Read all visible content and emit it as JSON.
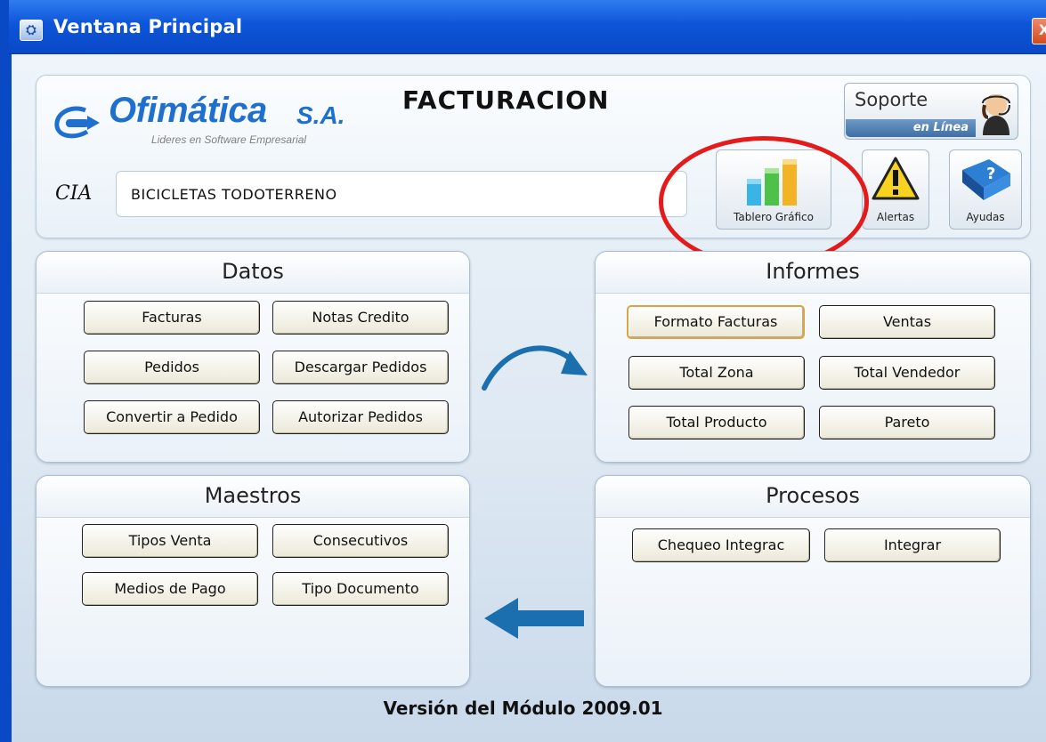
{
  "window": {
    "title": "Ventana Principal",
    "close_label": "X"
  },
  "header": {
    "logo_name": "Ofimática",
    "logo_suffix": "S.A.",
    "logo_slogan": "Lideres en Software Empresarial",
    "module_title": "FACTURACION",
    "support": {
      "label": "Soporte",
      "sub_label": "en Línea"
    },
    "cia_label": "CIA",
    "cia_value": "BICICLETAS TODOTERRENO",
    "tools": {
      "dashboard_label": "Tablero Gráfico",
      "alerts_label": "Alertas",
      "help_label": "Ayudas"
    }
  },
  "panels": {
    "datos": {
      "title": "Datos",
      "buttons": [
        "Facturas",
        "Notas Credito",
        "Pedidos",
        "Descargar Pedidos",
        "Convertir a Pedido",
        "Autorizar Pedidos"
      ]
    },
    "informes": {
      "title": "Informes",
      "buttons": [
        "Formato Facturas",
        "Ventas",
        "Total Zona",
        "Total Vendedor",
        "Total Producto",
        "Pareto"
      ]
    },
    "maestros": {
      "title": "Maestros",
      "buttons": [
        "Tipos Venta",
        "Consecutivos",
        "Medios de Pago",
        "Tipo Documento"
      ]
    },
    "procesos": {
      "title": "Procesos",
      "buttons": [
        "Chequeo Integrac",
        "Integrar"
      ]
    }
  },
  "footer": {
    "version": "Versión del Módulo 2009.01"
  },
  "colors": {
    "titlebar": "#0d55d8",
    "highlight": "#e31b1b",
    "logo_blue": "#1f6fcf",
    "arrow_blue": "#1c6fae"
  }
}
